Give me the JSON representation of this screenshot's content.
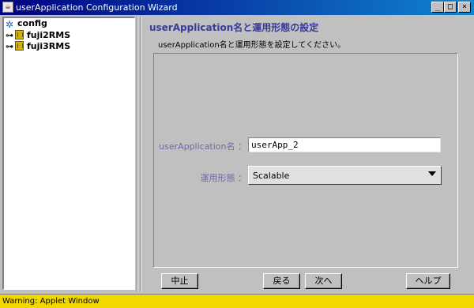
{
  "window": {
    "title": "userApplication Configuration Wizard",
    "icon": "java-applet-icon",
    "controls": {
      "minimize": "_",
      "maximize": "□",
      "close": "×"
    }
  },
  "tree": {
    "root": {
      "label": "config",
      "icon": "config-icon"
    },
    "items": [
      {
        "label": "fuji2RMS",
        "icon": "host-icon",
        "expander": "⊶"
      },
      {
        "label": "fuji3RMS",
        "icon": "host-icon",
        "expander": "⊶"
      }
    ]
  },
  "main": {
    "heading": "userApplication名と運用形態の設定",
    "instruction": "userApplication名と運用形態を設定してください。",
    "fields": {
      "name_label": "userApplication名 ：",
      "name_value": "userApp_2",
      "mode_label": "運用形態 ：",
      "mode_value": "Scalable"
    }
  },
  "buttons": {
    "cancel": "中止",
    "back": "戻る",
    "next": "次へ",
    "help": "ヘルプ"
  },
  "status": {
    "text": "Warning: Applet Window"
  },
  "colors": {
    "titlebar_start": "#000080",
    "titlebar_end": "#1084d0",
    "heading": "#3a3a9a",
    "label": "#6b6ba8",
    "status_background": "#f0d800"
  }
}
